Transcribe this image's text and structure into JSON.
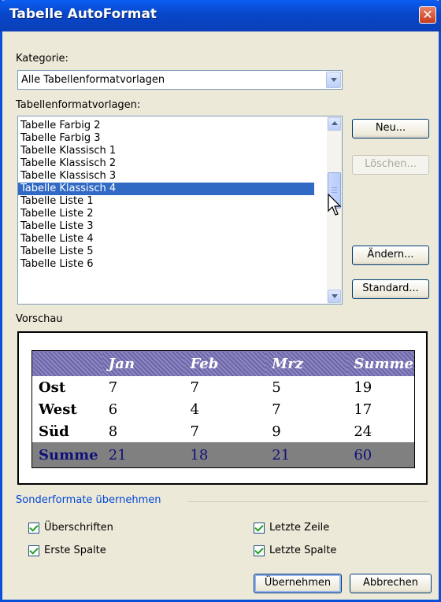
{
  "window": {
    "title": "Tabelle AutoFormat",
    "close": "✕"
  },
  "category": {
    "label": "Kategorie:",
    "value": "Alle Tabellenformatvorlagen"
  },
  "styles": {
    "label": "Tabellenformatvorlagen:",
    "items": [
      "Tabelle Farbig 2",
      "Tabelle Farbig 3",
      "Tabelle Klassisch 1",
      "Tabelle Klassisch 2",
      "Tabelle Klassisch 3",
      "Tabelle Klassisch 4",
      "Tabelle Liste 1",
      "Tabelle Liste 2",
      "Tabelle Liste 3",
      "Tabelle Liste 4",
      "Tabelle Liste 5",
      "Tabelle Liste 6"
    ],
    "selected": "Tabelle Klassisch 4"
  },
  "buttons": {
    "new": "Neu...",
    "delete": "Löschen...",
    "modify": "Ändern...",
    "default": "Standard...",
    "apply": "Übernehmen",
    "cancel": "Abbrechen"
  },
  "preview": {
    "label": "Vorschau",
    "headers": [
      "",
      "Jan",
      "Feb",
      "Mrz",
      "Summe"
    ],
    "rows": [
      [
        "Ost",
        "7",
        "7",
        "5",
        "19"
      ],
      [
        "West",
        "6",
        "4",
        "7",
        "17"
      ],
      [
        "Süd",
        "8",
        "7",
        "9",
        "24"
      ],
      [
        "Summe",
        "21",
        "18",
        "21",
        "60"
      ]
    ]
  },
  "special": {
    "label": "Sonderformate übernehmen",
    "headings": "Überschriften",
    "first_column": "Erste Spalte",
    "last_row": "Letzte Zeile",
    "last_column": "Letzte Spalte"
  }
}
